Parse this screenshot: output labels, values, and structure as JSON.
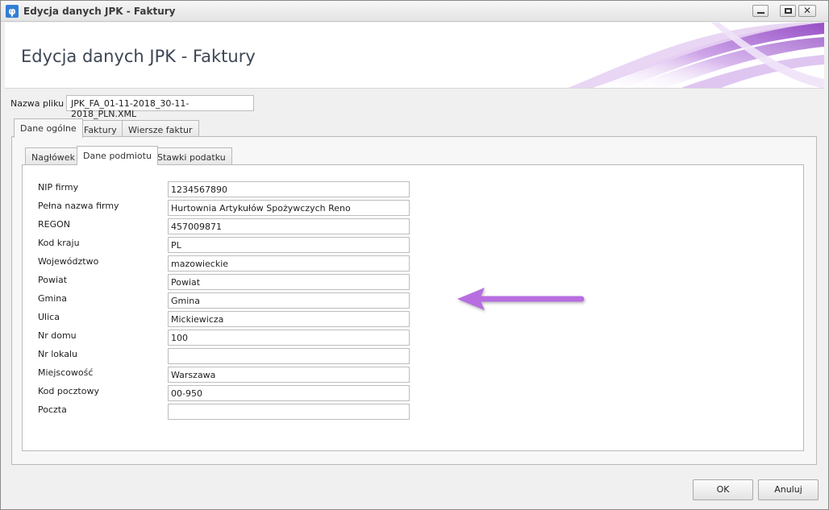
{
  "window": {
    "title": "Edycja danych JPK - Faktury",
    "app_icon": "phi-icon",
    "app_icon_glyph": "φ"
  },
  "banner": {
    "title": "Edycja danych JPK - Faktury"
  },
  "file": {
    "label": "Nazwa pliku",
    "value": "JPK_FA_01-11-2018_30-11-2018_PLN.XML"
  },
  "tabs": [
    {
      "label": "Dane ogólne"
    },
    {
      "label": "Faktury"
    },
    {
      "label": "Wiersze faktur"
    }
  ],
  "subtabs": [
    {
      "label": "Nagłówek"
    },
    {
      "label": "Dane podmiotu"
    },
    {
      "label": "Stawki podatku"
    }
  ],
  "fields": [
    {
      "label": "NIP firmy",
      "value": "1234567890"
    },
    {
      "label": "Pełna nazwa firmy",
      "value": "Hurtownia Artykułów Spożywczych Reno"
    },
    {
      "label": "REGON",
      "value": "457009871"
    },
    {
      "label": "Kod kraju",
      "value": "PL"
    },
    {
      "label": "Województwo",
      "value": "mazowieckie"
    },
    {
      "label": "Powiat",
      "value": "Powiat"
    },
    {
      "label": "Gmina",
      "value": "Gmina"
    },
    {
      "label": "Ulica",
      "value": "Mickiewicza"
    },
    {
      "label": "Nr domu",
      "value": "100"
    },
    {
      "label": "Nr lokalu",
      "value": ""
    },
    {
      "label": "Miejscowość",
      "value": "Warszawa"
    },
    {
      "label": "Kod pocztowy",
      "value": "00-950"
    },
    {
      "label": "Poczta",
      "value": ""
    }
  ],
  "buttons": {
    "ok": "OK",
    "cancel": "Anuluj"
  },
  "colors": {
    "arrow": "#b86ee0",
    "title_text": "#3d4655",
    "banner_swoosh": "#9a4fc8"
  }
}
